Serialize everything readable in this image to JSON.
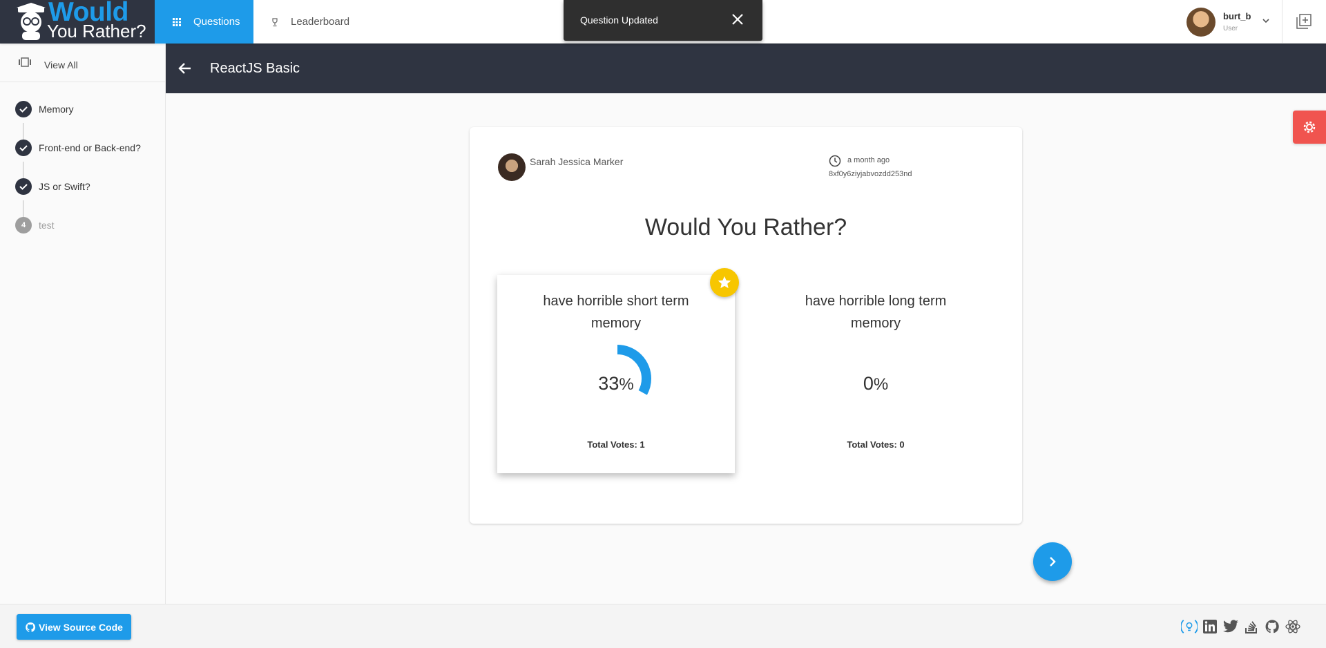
{
  "logo": {
    "line1": "Would",
    "line2": "You Rather?"
  },
  "nav": {
    "questions_label": "Questions",
    "leaderboard_label": "Leaderboard"
  },
  "toast": {
    "message": "Question Updated"
  },
  "user": {
    "name": "burt_b",
    "role": "User"
  },
  "sidebar": {
    "view_all_label": "View All",
    "steps": [
      {
        "label": "Memory",
        "status": "done"
      },
      {
        "label": "Front-end or Back-end?",
        "status": "done"
      },
      {
        "label": "JS or Swift?",
        "status": "done"
      },
      {
        "label": "test",
        "status": "pending",
        "number": "4"
      }
    ]
  },
  "page": {
    "title": "ReactJS Basic"
  },
  "question": {
    "author": "Sarah Jessica Marker",
    "time_ago": "a month ago",
    "id": "8xf0y6ziyjabvozdd253nd",
    "heading": "Would You Rather?",
    "options": [
      {
        "text": "have horrible short term memory",
        "percent_value": "33",
        "percent_symbol": "%",
        "percent": 33,
        "votes_label": "Total Votes: 1",
        "voted": true
      },
      {
        "text": "have horrible long term memory",
        "percent_value": "0",
        "percent_symbol": "%",
        "percent": 0,
        "votes_label": "Total Votes: 0",
        "voted": false
      }
    ]
  },
  "footer": {
    "source_button": "View Source Code"
  },
  "colors": {
    "accent": "#1e9be9",
    "dark": "#2f3441",
    "star": "#f7c600",
    "settings": "#f0544f"
  },
  "icons": {
    "nav": [
      "grid-icon",
      "trophy-icon"
    ],
    "social": [
      "idea-icon",
      "linkedin-icon",
      "twitter-icon",
      "stackoverflow-icon",
      "github-icon",
      "react-icon"
    ]
  }
}
